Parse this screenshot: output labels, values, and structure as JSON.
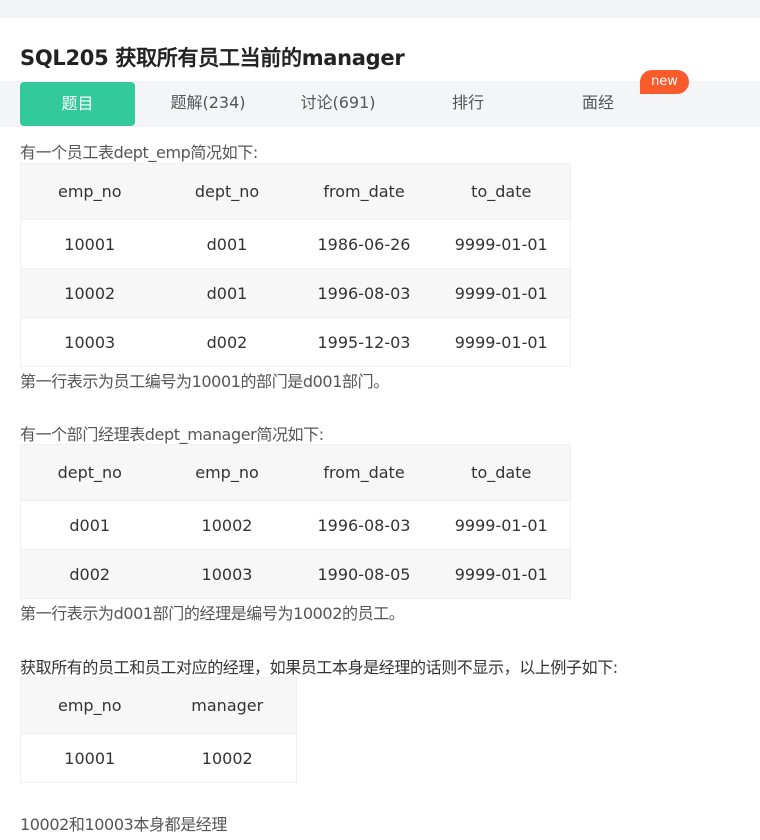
{
  "title": "SQL205  获取所有员工当前的manager",
  "tabs": [
    "题目",
    "题解(234)",
    "讨论(691)",
    "排行",
    "面经"
  ],
  "badge": "new",
  "para1": "有一个员工表dept_emp简况如下:",
  "table1": {
    "headers": [
      "emp_no",
      "dept_no",
      "from_date",
      "to_date"
    ],
    "rows": [
      [
        "10001",
        "d001",
        "1986-06-26",
        "9999-01-01"
      ],
      [
        "10002",
        "d001",
        "1996-08-03",
        "9999-01-01"
      ],
      [
        "10003",
        "d002",
        "1995-12-03",
        "9999-01-01"
      ]
    ]
  },
  "note1": "第一行表示为员工编号为10001的部门是d001部门。",
  "para2": "有一个部门经理表dept_manager简况如下:",
  "table2": {
    "headers": [
      "dept_no",
      "emp_no",
      "from_date",
      "to_date"
    ],
    "rows": [
      [
        "d001",
        "10002",
        "1996-08-03",
        "9999-01-01"
      ],
      [
        "d002",
        "10003",
        "1990-08-05",
        "9999-01-01"
      ]
    ]
  },
  "note2": "第一行表示为d001部门的经理是编号为10002的员工。",
  "para3": "获取所有的员工和员工对应的经理，如果员工本身是经理的话则不显示，以上例子如下:",
  "table3": {
    "headers": [
      "emp_no",
      "manager"
    ],
    "rows": [
      [
        "10001",
        "10002"
      ]
    ]
  },
  "footer": "10002和10003本身都是经理",
  "colors": {
    "accent": "#32ca99",
    "badge": "#fa5b2d"
  }
}
